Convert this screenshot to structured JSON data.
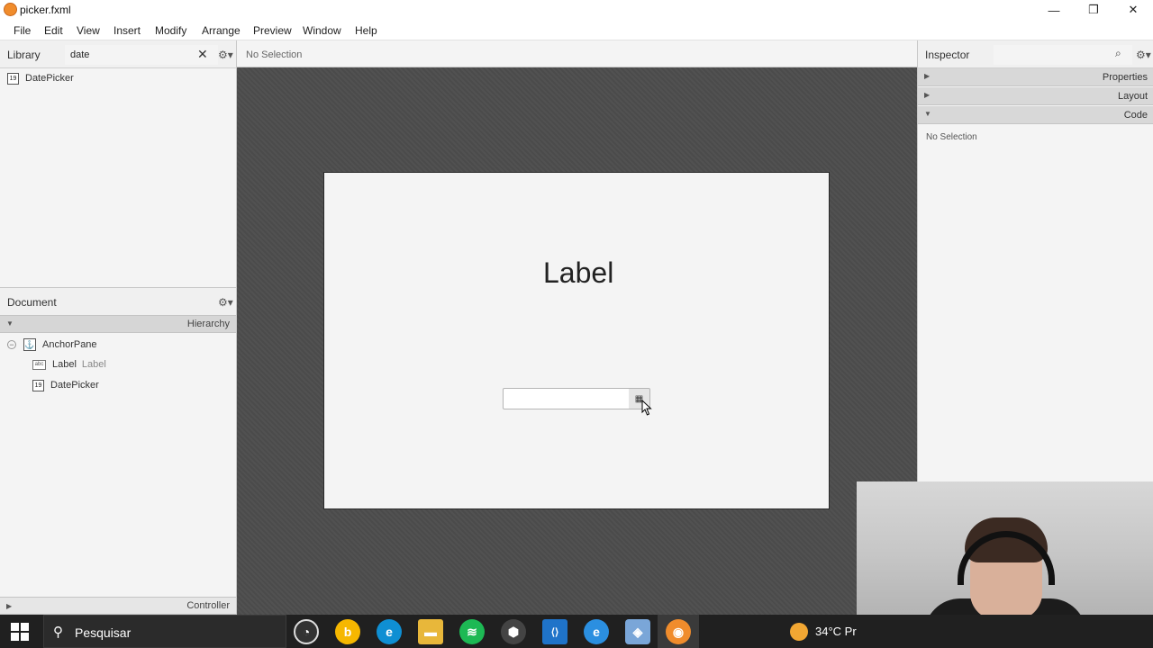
{
  "window": {
    "title": "picker.fxml",
    "minimize_glyph": "—",
    "restore_glyph": "❐",
    "close_glyph": "✕"
  },
  "menu": [
    "File",
    "Edit",
    "View",
    "Insert",
    "Modify",
    "Arrange",
    "Preview",
    "Window",
    "Help"
  ],
  "library": {
    "title": "Library",
    "search_value": "date",
    "clear_glyph": "✕",
    "gear_glyph": "⚙▾",
    "items": [
      {
        "icon_text": "19",
        "label": "DatePicker"
      }
    ]
  },
  "document": {
    "title": "Document",
    "gear_glyph": "⚙▾",
    "hierarchy_label": "Hierarchy",
    "controller_label": "Controller",
    "tree": {
      "root": {
        "label": "AnchorPane",
        "collapse_glyph": "−",
        "icon_glyph": "⚓"
      },
      "children": [
        {
          "icon_text": "abc",
          "label": "Label",
          "sublabel": "Label"
        },
        {
          "icon_text": "19",
          "label": "DatePicker",
          "sublabel": ""
        }
      ]
    }
  },
  "center": {
    "status": "No Selection",
    "design": {
      "label_text": "Label",
      "datepicker_value": "",
      "datepicker_button_glyph": "▦"
    }
  },
  "inspector": {
    "title": "Inspector",
    "search_value": "",
    "search_glyph": "⌕",
    "gear_glyph": "⚙▾",
    "sections": [
      {
        "label": "Properties",
        "expanded": false
      },
      {
        "label": "Layout",
        "expanded": false
      },
      {
        "label": "Code",
        "expanded": true
      }
    ],
    "no_selection": "No Selection"
  },
  "taskbar": {
    "search_placeholder": "Pesquisar",
    "search_glyph": "⚲",
    "apps": [
      {
        "name": "chrome-remote",
        "glyph": "◔",
        "color": "#333333"
      },
      {
        "name": "bing",
        "glyph": "b",
        "color": "#f6b700"
      },
      {
        "name": "edge",
        "glyph": "e",
        "color": "#0f8fd3"
      },
      {
        "name": "file-explorer",
        "glyph": "▬",
        "color": "#e8b73a"
      },
      {
        "name": "spotify",
        "glyph": "≋",
        "color": "#1db954"
      },
      {
        "name": "unity",
        "glyph": "⬢",
        "color": "#444444"
      },
      {
        "name": "vscode",
        "glyph": "⟨⟩",
        "color": "#1f73c9"
      },
      {
        "name": "internet-explorer",
        "glyph": "e",
        "color": "#2b8fe0"
      },
      {
        "name": "3d-app",
        "glyph": "◈",
        "color": "#7aa6d8"
      },
      {
        "name": "scene-builder",
        "glyph": "◉",
        "color": "#f08c2c"
      }
    ],
    "weather": {
      "temp": "34°C",
      "extra": "Pr"
    }
  },
  "colors": {
    "canvas_background": "#4d4d4d",
    "taskbar": "#202020",
    "accent_orange": "#f08c2c"
  }
}
